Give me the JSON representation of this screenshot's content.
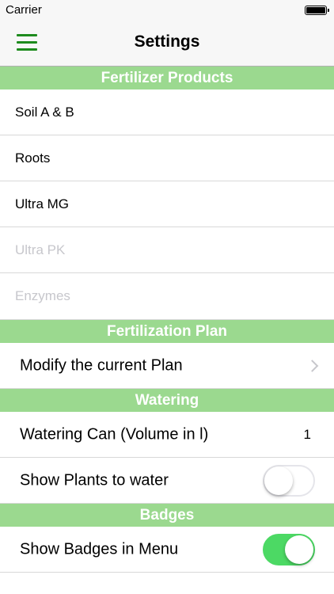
{
  "status_bar": {
    "carrier": "Carrier"
  },
  "nav": {
    "title": "Settings"
  },
  "sections": {
    "fertilizer": {
      "header": "Fertilizer Products",
      "items": [
        "Soil A & B",
        "Roots",
        "Ultra MG",
        "Ultra PK",
        "Enzymes"
      ]
    },
    "plan": {
      "header": "Fertilization Plan",
      "modify_label": "Modify the current Plan"
    },
    "watering": {
      "header": "Watering",
      "can_label": "Watering Can (Volume in l)",
      "can_value": "1",
      "show_plants_label": "Show Plants to water",
      "show_plants_on": false
    },
    "badges": {
      "header": "Badges",
      "show_badges_label": "Show Badges in Menu",
      "show_badges_on": true
    }
  },
  "colors": {
    "section_header_bg": "#9bd98f",
    "toggle_on": "#4cd964",
    "menu_icon": "#1e8b1e"
  },
  "icons": {
    "menu": "hamburger-menu-icon",
    "battery": "battery-icon",
    "chevron": "chevron-right-icon"
  }
}
